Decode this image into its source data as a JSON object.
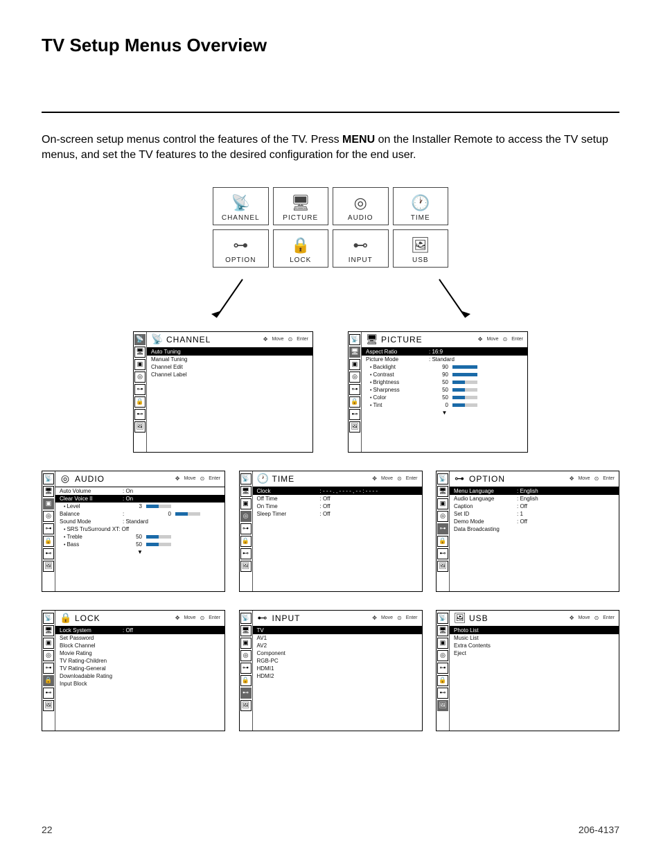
{
  "title": "TV Setup Menus Overview",
  "intro_before": "On-screen setup menus control the features of the TV. Press ",
  "intro_bold": "MENU",
  "intro_after": " on the Installer Remote to access the TV setup menus, and set the TV features to the desired configuration for the end user.",
  "nav": {
    "move": "Move",
    "enter": "Enter"
  },
  "main_menu": [
    {
      "label": "CHANNEL",
      "icon": "📡"
    },
    {
      "label": "PICTURE",
      "icon": "🖥"
    },
    {
      "label": "AUDIO",
      "icon": "◎"
    },
    {
      "label": "TIME",
      "icon": "🕐"
    },
    {
      "label": "OPTION",
      "icon": "⊶"
    },
    {
      "label": "LOCK",
      "icon": "🔒"
    },
    {
      "label": "INPUT",
      "icon": "⊷"
    },
    {
      "label": "USB",
      "icon": "🖼"
    }
  ],
  "panels": {
    "channel": {
      "title": "CHANNEL",
      "icon": "📡",
      "items": [
        {
          "label": "Auto Tuning",
          "selected": true
        },
        {
          "label": "Manual Tuning"
        },
        {
          "label": "Channel Edit"
        },
        {
          "label": "Channel Label"
        }
      ]
    },
    "picture": {
      "title": "PICTURE",
      "icon": "🖥",
      "items": [
        {
          "label": "Aspect Ratio",
          "value": ": 16:9",
          "selected": true
        },
        {
          "label": "Picture Mode",
          "value": ": Standard"
        },
        {
          "sub": "Backlight",
          "num": "90",
          "bar": "full"
        },
        {
          "sub": "Contrast",
          "num": "90",
          "bar": "full"
        },
        {
          "sub": "Brightness",
          "num": "50",
          "bar": "half"
        },
        {
          "sub": "Sharpness",
          "num": "50",
          "bar": "half"
        },
        {
          "sub": "Color",
          "num": "50",
          "bar": "half"
        },
        {
          "sub": "Tint",
          "num": "0",
          "bar": "half"
        }
      ],
      "more": "▼"
    },
    "audio": {
      "title": "AUDIO",
      "icon": "◎",
      "items": [
        {
          "label": "Auto Volume",
          "value": ": On"
        },
        {
          "label": "Clear Voice II",
          "value": ": On",
          "selected": true
        },
        {
          "sub": "Level",
          "num": "3",
          "bar": "half"
        },
        {
          "label": "Balance",
          "value": ":",
          "num": "0",
          "bar": "half"
        },
        {
          "label": "Sound Mode",
          "value": ": Standard"
        },
        {
          "sub": "SRS TruSurround XT:  Off"
        },
        {
          "sub": "Treble",
          "num": "50",
          "bar": "half"
        },
        {
          "sub": "Bass",
          "num": "50",
          "bar": "half"
        }
      ],
      "more": "▼"
    },
    "time": {
      "title": "TIME",
      "icon": "🕐",
      "items": [
        {
          "label": "Clock",
          "value": ": - - - . , - - - - , - - : - -  - -",
          "selected": true
        },
        {
          "label": "Off Time",
          "value": ": Off"
        },
        {
          "label": "On Time",
          "value": ": Off"
        },
        {
          "label": "Sleep Timer",
          "value": ": Off"
        }
      ]
    },
    "option": {
      "title": "OPTION",
      "icon": "⊶",
      "items": [
        {
          "label": "Menu Language",
          "value": ": English",
          "selected": true
        },
        {
          "label": "Audio Language",
          "value": ": English"
        },
        {
          "label": "Caption",
          "value": ": Off"
        },
        {
          "label": "Set ID",
          "value": ": 1"
        },
        {
          "label": "Demo Mode",
          "value": ": Off"
        },
        {
          "label": "Data Broadcasting"
        }
      ]
    },
    "lock": {
      "title": "LOCK",
      "icon": "🔒",
      "items": [
        {
          "label": "Lock System",
          "value": ": Off",
          "selected": true
        },
        {
          "label": "Set Password"
        },
        {
          "label": "Block  Channel"
        },
        {
          "label": "Movie Rating"
        },
        {
          "label": "TV Rating-Children"
        },
        {
          "label": "TV Rating-General"
        },
        {
          "label": "Downloadable Rating"
        },
        {
          "label": "Input Block"
        }
      ]
    },
    "input": {
      "title": "INPUT",
      "icon": "⊷",
      "items": [
        {
          "label": "TV",
          "selected": true
        },
        {
          "label": "AV1"
        },
        {
          "label": "AV2"
        },
        {
          "label": "Component"
        },
        {
          "label": "RGB-PC"
        },
        {
          "label": "HDMI1"
        },
        {
          "label": "HDMI2"
        }
      ]
    },
    "usb": {
      "title": "USB",
      "icon": "🖼",
      "items": [
        {
          "label": "Photo List",
          "selected": true
        },
        {
          "label": "Music List"
        },
        {
          "label": "Extra Contents"
        },
        {
          "label": "Eject"
        }
      ]
    }
  },
  "strip_icons": [
    "📡",
    "🖥",
    "▣",
    "◎",
    "⊶",
    "🔒",
    "⊷",
    "🖼"
  ],
  "footer": {
    "page": "22",
    "doc": "206-4137"
  }
}
